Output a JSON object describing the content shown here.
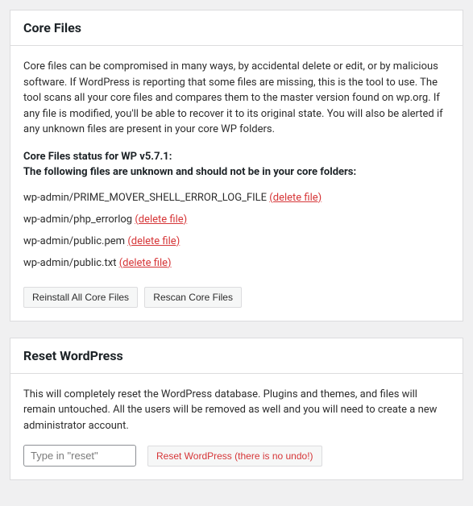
{
  "coreFiles": {
    "title": "Core Files",
    "description": "Core files can be compromised in many ways, by accidental delete or edit, or by malicious software. If WordPress is reporting that some files are missing, this is the tool to use. The tool scans all your core files and compares them to the master version found on wp.org. If any file is modified, you'll be able to recover it to its original state. You will also be alerted if any unknown files are present in your core WP folders.",
    "statusLabel": "Core Files status for WP v5.7.1:",
    "unknownLabel": "The following files are unknown and should not be in your core folders:",
    "deleteLabel": "(delete file)",
    "files": [
      "wp-admin/PRIME_MOVER_SHELL_ERROR_LOG_FILE",
      "wp-admin/php_errorlog",
      "wp-admin/public.pem",
      "wp-admin/public.txt"
    ],
    "reinstallLabel": "Reinstall All Core Files",
    "rescanLabel": "Rescan Core Files"
  },
  "resetWp": {
    "title": "Reset WordPress",
    "description": "This will completely reset the WordPress database. Plugins and themes, and files will remain untouched. All the users will be removed as well and you will need to create a new administrator account.",
    "inputPlaceholder": "Type in \"reset\"",
    "resetLabel": "Reset WordPress (there is no undo!)"
  }
}
